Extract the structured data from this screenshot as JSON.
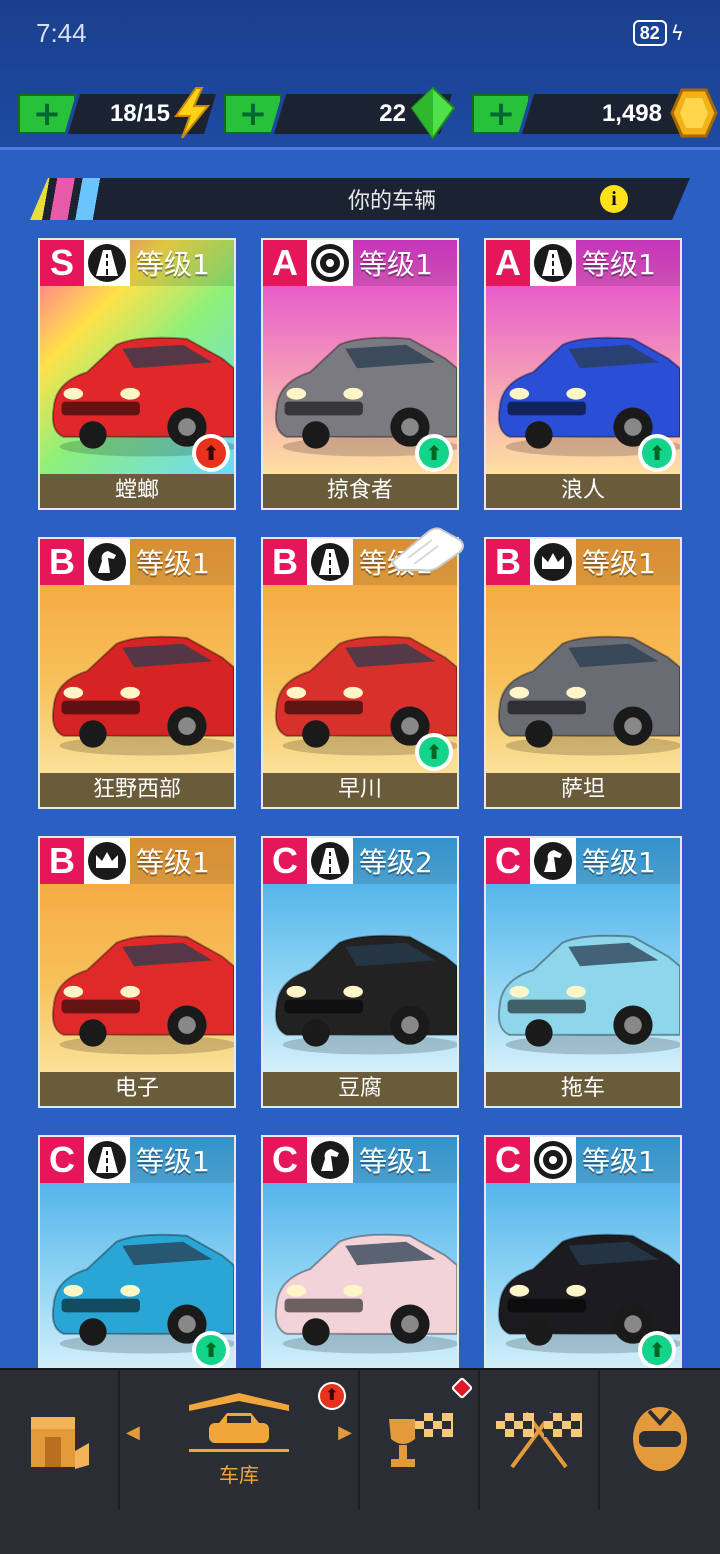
{
  "status_bar": {
    "time": "7:44",
    "battery": "82"
  },
  "resources": [
    {
      "value": "18/15",
      "icon": "lightning-icon",
      "color": "#ffd21a"
    },
    {
      "value": "22",
      "icon": "gem-icon",
      "color": "#4fe04a"
    },
    {
      "value": "1,498",
      "icon": "coin-icon",
      "color": "#f2b21a"
    }
  ],
  "section": {
    "title": "你的车辆"
  },
  "cars": [
    {
      "rank": "S",
      "class_icon": "road-icon",
      "level": "等级1",
      "name": "螳螂",
      "upgrade": "red"
    },
    {
      "rank": "A",
      "class_icon": "tire-icon",
      "level": "等级1",
      "name": "掠食者",
      "upgrade": "green"
    },
    {
      "rank": "A",
      "class_icon": "road-icon",
      "level": "等级1",
      "name": "浪人",
      "upgrade": "green"
    },
    {
      "rank": "B",
      "class_icon": "horse-icon",
      "level": "等级1",
      "name": "狂野西部",
      "upgrade": ""
    },
    {
      "rank": "B",
      "class_icon": "road-icon",
      "level": "等级1",
      "name": "早川",
      "upgrade": "green"
    },
    {
      "rank": "B",
      "class_icon": "crown-icon",
      "level": "等级1",
      "name": "萨坦",
      "upgrade": ""
    },
    {
      "rank": "B",
      "class_icon": "crown-icon",
      "level": "等级1",
      "name": "电子",
      "upgrade": ""
    },
    {
      "rank": "C",
      "class_icon": "road-icon",
      "level": "等级2",
      "name": "豆腐",
      "upgrade": ""
    },
    {
      "rank": "C",
      "class_icon": "horse-icon",
      "level": "等级1",
      "name": "拖车",
      "upgrade": ""
    },
    {
      "rank": "C",
      "class_icon": "road-icon",
      "level": "等级1",
      "name": "",
      "upgrade": "green"
    },
    {
      "rank": "C",
      "class_icon": "horse-icon",
      "level": "等级1",
      "name": "",
      "upgrade": ""
    },
    {
      "rank": "C",
      "class_icon": "tire-icon",
      "level": "等级1",
      "name": "",
      "upgrade": "green"
    }
  ],
  "nav": {
    "garage_label": "车库"
  }
}
